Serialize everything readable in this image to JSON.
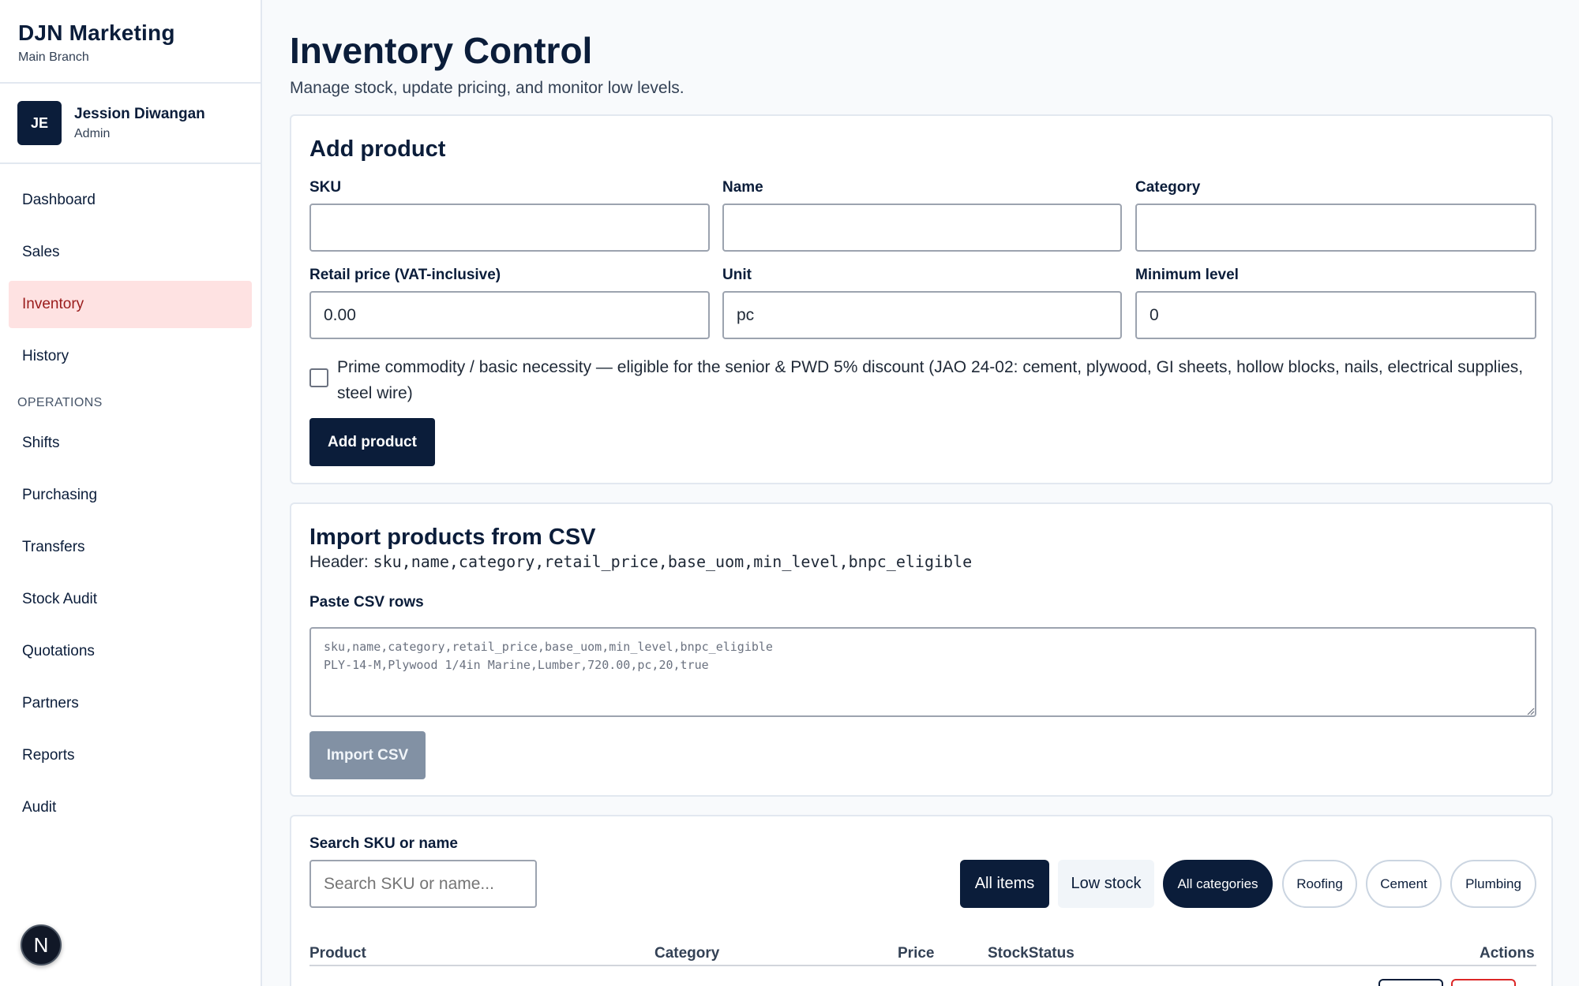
{
  "brand": {
    "name": "DJN Marketing",
    "branch": "Main Branch"
  },
  "user": {
    "initials": "JE",
    "name": "Jession Diwangan",
    "role": "Admin"
  },
  "nav": {
    "main": [
      {
        "id": "dashboard",
        "label": "Dashboard"
      },
      {
        "id": "sales",
        "label": "Sales"
      },
      {
        "id": "inventory",
        "label": "Inventory"
      },
      {
        "id": "history",
        "label": "History"
      }
    ],
    "section_label": "OPERATIONS",
    "operations": [
      {
        "id": "shifts",
        "label": "Shifts"
      },
      {
        "id": "purchasing",
        "label": "Purchasing"
      },
      {
        "id": "transfers",
        "label": "Transfers"
      },
      {
        "id": "stock-audit",
        "label": "Stock Audit"
      },
      {
        "id": "quotations",
        "label": "Quotations"
      },
      {
        "id": "partners",
        "label": "Partners"
      },
      {
        "id": "reports",
        "label": "Reports"
      },
      {
        "id": "audit",
        "label": "Audit"
      }
    ],
    "fab_label": "N"
  },
  "page": {
    "title": "Inventory Control",
    "subtitle": "Manage stock, update pricing, and monitor low levels."
  },
  "add_product": {
    "title": "Add product",
    "sku_label": "SKU",
    "sku_value": "",
    "name_label": "Name",
    "name_value": "",
    "category_label": "Category",
    "category_value": "",
    "price_label": "Retail price (VAT-inclusive)",
    "price_value": "0.00",
    "unit_label": "Unit",
    "unit_value": "pc",
    "min_label": "Minimum level",
    "min_value": "0",
    "bnpc_text": "Prime commodity / basic necessity — eligible for the senior & PWD 5% discount (JAO 24-02: cement, plywood, GI sheets, hollow blocks, nails, electrical supplies, steel wire)",
    "submit_label": "Add product"
  },
  "import_csv": {
    "title": "Import products from CSV",
    "header_prefix": "Header:",
    "header_fields": "sku,name,category,retail_price,base_uom,min_level,bnpc_eligible",
    "paste_label": "Paste CSV rows",
    "placeholder": "sku,name,category,retail_price,base_uom,min_level,bnpc_eligible\nPLY-14-M,Plywood 1/4in Marine,Lumber,720.00,pc,20,true",
    "submit_label": "Import CSV"
  },
  "list": {
    "search_label": "Search SKU or name",
    "search_placeholder": "Search SKU or name...",
    "filters": {
      "all_items": "All items",
      "low_stock": "Low stock"
    },
    "categories": [
      "All categories",
      "Roofing",
      "Cement",
      "Plumbing"
    ],
    "columns": {
      "product": "Product",
      "category": "Category",
      "price": "Price",
      "stock_status": "StockStatus",
      "actions": "Actions"
    }
  },
  "colors": {
    "primary": "#0b1d3a",
    "active_bg": "#fee2e2",
    "active_text": "#991b1b",
    "disabled": "#8291a4"
  }
}
